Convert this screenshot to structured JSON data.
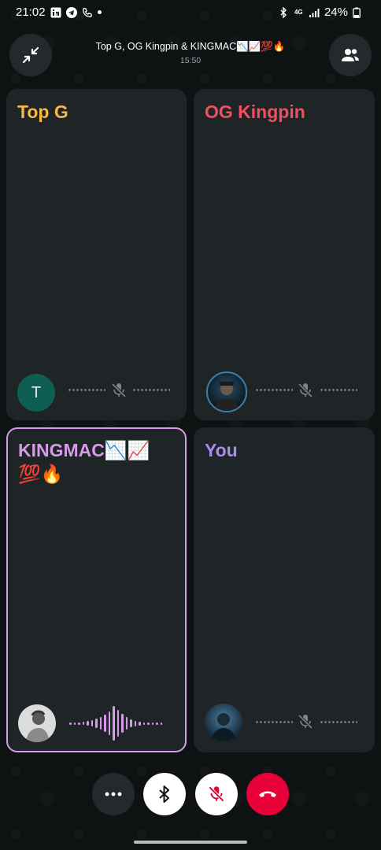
{
  "status_bar": {
    "time": "21:02",
    "battery": "24%",
    "network": "4G",
    "icons": [
      "linkedin-icon",
      "telegram-icon",
      "phone-icon",
      "dot-icon",
      "bluetooth-icon",
      "signal-icon",
      "battery-icon"
    ]
  },
  "header": {
    "title": "Top G, OG Kingpin & KINGMAC📉📈💯🔥",
    "duration": "15:50",
    "minimize_icon": "minimize-icon",
    "participants_icon": "participants-icon"
  },
  "participants": [
    {
      "name": "Top G",
      "color": "#f5b84a",
      "avatar_letter": "T",
      "avatar_color": "#0f5e52",
      "muted": true
    },
    {
      "name": "OG Kingpin",
      "color": "#ef4f5f",
      "avatar_color": "#35576e",
      "muted": true
    },
    {
      "name": "KINGMAC📉📈\n💯🔥",
      "color": "#d59be6",
      "avatar_color": "#d9d9d9",
      "speaking": true
    },
    {
      "name": "You",
      "color": "#a98bf0",
      "avatar_color": "#2a4a63",
      "muted": true
    }
  ],
  "controls": {
    "more": "more-options-icon",
    "bluetooth": "bluetooth-icon",
    "mute": "mic-off-icon",
    "end_call": "end-call-icon",
    "colors": {
      "more_bg": "#24292c",
      "bt_bg": "#ffffff",
      "mute_bg": "#ffffff",
      "end_bg": "#ea0038"
    }
  }
}
